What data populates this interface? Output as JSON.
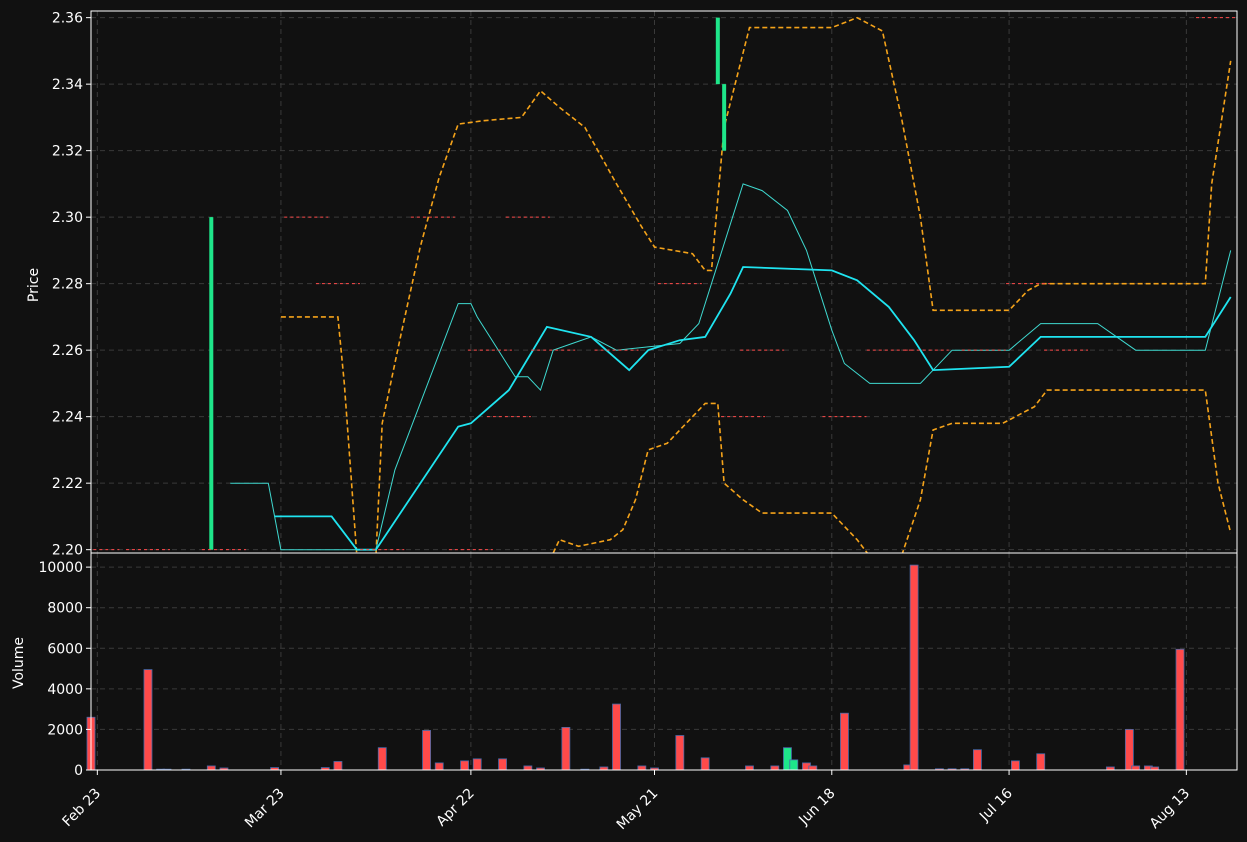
{
  "chart_data": [
    {
      "type": "candlestick",
      "ylabel": "Price",
      "ylim": [
        2.199,
        2.362
      ],
      "ytick_values": [
        2.2,
        2.22,
        2.24,
        2.26,
        2.28,
        2.3,
        2.32,
        2.34,
        2.36
      ],
      "ytick_labels": [
        "2.20",
        "2.22",
        "2.24",
        "2.26",
        "2.28",
        "2.30",
        "2.32",
        "2.34",
        "2.36"
      ],
      "xlim": [
        "2024-02-22",
        "2024-08-21"
      ],
      "xtick_values": [
        "2024-02-23",
        "2024-03-23",
        "2024-04-22",
        "2024-05-21",
        "2024-06-18",
        "2024-07-16",
        "2024-08-13"
      ],
      "xtick_labels": [
        "Feb 23",
        "Mar 23",
        "Apr 22",
        "May 21",
        "Jun 18",
        "Jul 16",
        "Aug 13"
      ],
      "grid": true,
      "colors": {
        "up": "#1ee68a",
        "down": "#ff4a4a",
        "sma_fast": "#3fd9d0",
        "sma_slow": "#1fe4f0",
        "bands": "#f5a31a",
        "background": "#111111"
      },
      "candles": [
        {
          "date": "2024-02-23",
          "open": 2.2,
          "high": 2.2,
          "low": 2.2,
          "close": 2.2
        },
        {
          "date": "2024-03-02",
          "open": 2.2,
          "high": 2.2,
          "low": 2.2,
          "close": 2.2
        },
        {
          "date": "2024-03-12",
          "open": 2.2,
          "high": 2.3,
          "low": 2.2,
          "close": 2.3
        },
        {
          "date": "2024-03-14",
          "open": 2.2,
          "high": 2.2,
          "low": 2.2,
          "close": 2.2
        },
        {
          "date": "2024-03-27",
          "open": 2.3,
          "high": 2.3,
          "low": 2.3,
          "close": 2.3
        },
        {
          "date": "2024-04-01",
          "open": 2.28,
          "high": 2.28,
          "low": 2.28,
          "close": 2.28
        },
        {
          "date": "2024-04-08",
          "open": 2.2,
          "high": 2.2,
          "low": 2.2,
          "close": 2.2
        },
        {
          "date": "2024-04-16",
          "open": 2.3,
          "high": 2.3,
          "low": 2.3,
          "close": 2.3
        },
        {
          "date": "2024-04-22",
          "open": 2.2,
          "high": 2.2,
          "low": 2.2,
          "close": 2.2
        },
        {
          "date": "2024-04-25",
          "open": 2.26,
          "high": 2.26,
          "low": 2.26,
          "close": 2.26
        },
        {
          "date": "2024-04-28",
          "open": 2.24,
          "high": 2.24,
          "low": 2.24,
          "close": 2.24
        },
        {
          "date": "2024-05-01",
          "open": 2.3,
          "high": 2.3,
          "low": 2.3,
          "close": 2.3
        },
        {
          "date": "2024-05-05",
          "open": 2.26,
          "high": 2.26,
          "low": 2.26,
          "close": 2.26
        },
        {
          "date": "2024-05-15",
          "open": 2.26,
          "high": 2.26,
          "low": 2.26,
          "close": 2.26
        },
        {
          "date": "2024-05-25",
          "open": 2.28,
          "high": 2.28,
          "low": 2.28,
          "close": 2.28
        },
        {
          "date": "2024-05-31",
          "open": 2.34,
          "high": 2.36,
          "low": 2.34,
          "close": 2.36
        },
        {
          "date": "2024-06-01",
          "open": 2.32,
          "high": 2.34,
          "low": 2.32,
          "close": 2.34
        },
        {
          "date": "2024-06-04",
          "open": 2.24,
          "high": 2.24,
          "low": 2.24,
          "close": 2.24
        },
        {
          "date": "2024-06-07",
          "open": 2.26,
          "high": 2.26,
          "low": 2.26,
          "close": 2.26
        },
        {
          "date": "2024-06-20",
          "open": 2.24,
          "high": 2.24,
          "low": 2.24,
          "close": 2.24
        },
        {
          "date": "2024-06-27",
          "open": 2.26,
          "high": 2.26,
          "low": 2.26,
          "close": 2.26
        },
        {
          "date": "2024-07-03",
          "open": 2.26,
          "high": 2.26,
          "low": 2.26,
          "close": 2.26
        },
        {
          "date": "2024-07-12",
          "open": 2.26,
          "high": 2.26,
          "low": 2.26,
          "close": 2.26
        },
        {
          "date": "2024-07-19",
          "open": 2.28,
          "high": 2.28,
          "low": 2.28,
          "close": 2.28
        },
        {
          "date": "2024-07-25",
          "open": 2.26,
          "high": 2.26,
          "low": 2.26,
          "close": 2.26
        },
        {
          "date": "2024-08-18",
          "open": 2.36,
          "high": 2.36,
          "low": 2.36,
          "close": 2.36
        }
      ],
      "sma_fast": [
        {
          "date": "2024-03-15",
          "value": 2.22
        },
        {
          "date": "2024-03-21",
          "value": 2.22
        },
        {
          "date": "2024-03-23",
          "value": 2.2
        },
        {
          "date": "2024-04-03",
          "value": 2.2
        },
        {
          "date": "2024-04-07",
          "value": 2.2
        },
        {
          "date": "2024-04-10",
          "value": 2.224
        },
        {
          "date": "2024-04-20",
          "value": 2.274
        },
        {
          "date": "2024-04-22",
          "value": 2.274
        },
        {
          "date": "2024-04-23",
          "value": 2.27
        },
        {
          "date": "2024-04-25",
          "value": 2.264
        },
        {
          "date": "2024-04-29",
          "value": 2.252
        },
        {
          "date": "2024-05-01",
          "value": 2.252
        },
        {
          "date": "2024-05-03",
          "value": 2.248
        },
        {
          "date": "2024-05-05",
          "value": 2.26
        },
        {
          "date": "2024-05-08",
          "value": 2.262
        },
        {
          "date": "2024-05-11",
          "value": 2.264
        },
        {
          "date": "2024-05-15",
          "value": 2.26
        },
        {
          "date": "2024-05-25",
          "value": 2.262
        },
        {
          "date": "2024-05-28",
          "value": 2.268
        },
        {
          "date": "2024-05-31",
          "value": 2.286
        },
        {
          "date": "2024-06-04",
          "value": 2.31
        },
        {
          "date": "2024-06-07",
          "value": 2.308
        },
        {
          "date": "2024-06-11",
          "value": 2.302
        },
        {
          "date": "2024-06-14",
          "value": 2.29
        },
        {
          "date": "2024-06-18",
          "value": 2.266
        },
        {
          "date": "2024-06-20",
          "value": 2.256
        },
        {
          "date": "2024-06-24",
          "value": 2.25
        },
        {
          "date": "2024-07-02",
          "value": 2.25
        },
        {
          "date": "2024-07-07",
          "value": 2.26
        },
        {
          "date": "2024-07-16",
          "value": 2.26
        },
        {
          "date": "2024-07-21",
          "value": 2.268
        },
        {
          "date": "2024-07-30",
          "value": 2.268
        },
        {
          "date": "2024-08-05",
          "value": 2.26
        },
        {
          "date": "2024-08-16",
          "value": 2.26
        },
        {
          "date": "2024-08-20",
          "value": 2.29
        }
      ],
      "sma_slow": [
        {
          "date": "2024-03-22",
          "value": 2.21
        },
        {
          "date": "2024-03-31",
          "value": 2.21
        },
        {
          "date": "2024-04-04",
          "value": 2.2
        },
        {
          "date": "2024-04-07",
          "value": 2.2
        },
        {
          "date": "2024-04-20",
          "value": 2.237
        },
        {
          "date": "2024-04-22",
          "value": 2.238
        },
        {
          "date": "2024-04-28",
          "value": 2.248
        },
        {
          "date": "2024-05-04",
          "value": 2.267
        },
        {
          "date": "2024-05-11",
          "value": 2.264
        },
        {
          "date": "2024-05-17",
          "value": 2.254
        },
        {
          "date": "2024-05-20",
          "value": 2.26
        },
        {
          "date": "2024-05-25",
          "value": 2.263
        },
        {
          "date": "2024-05-29",
          "value": 2.264
        },
        {
          "date": "2024-06-02",
          "value": 2.277
        },
        {
          "date": "2024-06-04",
          "value": 2.285
        },
        {
          "date": "2024-06-18",
          "value": 2.284
        },
        {
          "date": "2024-06-22",
          "value": 2.281
        },
        {
          "date": "2024-06-27",
          "value": 2.273
        },
        {
          "date": "2024-07-01",
          "value": 2.263
        },
        {
          "date": "2024-07-04",
          "value": 2.254
        },
        {
          "date": "2024-07-16",
          "value": 2.255
        },
        {
          "date": "2024-07-21",
          "value": 2.264
        },
        {
          "date": "2024-08-16",
          "value": 2.264
        },
        {
          "date": "2024-08-20",
          "value": 2.276
        }
      ],
      "band_upper": [
        {
          "date": "2024-03-23",
          "value": 2.27
        },
        {
          "date": "2024-04-01",
          "value": 2.27
        },
        {
          "date": "2024-04-02",
          "value": 2.25
        },
        {
          "date": "2024-04-04",
          "value": 2.198
        },
        {
          "date": "2024-04-07",
          "value": 2.198
        },
        {
          "date": "2024-04-08",
          "value": 2.238
        },
        {
          "date": "2024-04-11",
          "value": 2.265
        },
        {
          "date": "2024-04-14",
          "value": 2.291
        },
        {
          "date": "2024-04-17",
          "value": 2.312
        },
        {
          "date": "2024-04-20",
          "value": 2.328
        },
        {
          "date": "2024-04-24",
          "value": 2.329
        },
        {
          "date": "2024-04-30",
          "value": 2.33
        },
        {
          "date": "2024-05-03",
          "value": 2.338
        },
        {
          "date": "2024-05-06",
          "value": 2.333
        },
        {
          "date": "2024-05-10",
          "value": 2.327
        },
        {
          "date": "2024-05-15",
          "value": 2.31
        },
        {
          "date": "2024-05-19",
          "value": 2.297
        },
        {
          "date": "2024-05-21",
          "value": 2.291
        },
        {
          "date": "2024-05-27",
          "value": 2.289
        },
        {
          "date": "2024-05-29",
          "value": 2.284
        },
        {
          "date": "2024-05-30",
          "value": 2.284
        },
        {
          "date": "2024-06-01",
          "value": 2.327
        },
        {
          "date": "2024-06-05",
          "value": 2.357
        },
        {
          "date": "2024-06-18",
          "value": 2.357
        },
        {
          "date": "2024-06-22",
          "value": 2.36
        },
        {
          "date": "2024-06-26",
          "value": 2.356
        },
        {
          "date": "2024-06-29",
          "value": 2.33
        },
        {
          "date": "2024-07-02",
          "value": 2.3
        },
        {
          "date": "2024-07-04",
          "value": 2.272
        },
        {
          "date": "2024-07-16",
          "value": 2.272
        },
        {
          "date": "2024-07-19",
          "value": 2.278
        },
        {
          "date": "2024-07-21",
          "value": 2.28
        },
        {
          "date": "2024-08-16",
          "value": 2.28
        },
        {
          "date": "2024-08-17",
          "value": 2.31
        },
        {
          "date": "2024-08-20",
          "value": 2.347
        }
      ],
      "band_lower": [
        {
          "date": "2024-05-05",
          "value": 2.199
        },
        {
          "date": "2024-05-06",
          "value": 2.203
        },
        {
          "date": "2024-05-09",
          "value": 2.201
        },
        {
          "date": "2024-05-14",
          "value": 2.203
        },
        {
          "date": "2024-05-16",
          "value": 2.206
        },
        {
          "date": "2024-05-18",
          "value": 2.215
        },
        {
          "date": "2024-05-20",
          "value": 2.23
        },
        {
          "date": "2024-05-23",
          "value": 2.232
        },
        {
          "date": "2024-05-27",
          "value": 2.24
        },
        {
          "date": "2024-05-29",
          "value": 2.244
        },
        {
          "date": "2024-05-31",
          "value": 2.244
        },
        {
          "date": "2024-06-01",
          "value": 2.22
        },
        {
          "date": "2024-06-04",
          "value": 2.215
        },
        {
          "date": "2024-06-07",
          "value": 2.211
        },
        {
          "date": "2024-06-18",
          "value": 2.211
        },
        {
          "date": "2024-06-22",
          "value": 2.203
        },
        {
          "date": "2024-06-24",
          "value": 2.198
        },
        {
          "date": "2024-06-29",
          "value": 2.198
        },
        {
          "date": "2024-07-02",
          "value": 2.215
        },
        {
          "date": "2024-07-04",
          "value": 2.236
        },
        {
          "date": "2024-07-07",
          "value": 2.238
        },
        {
          "date": "2024-07-15",
          "value": 2.238
        },
        {
          "date": "2024-07-17",
          "value": 2.24
        },
        {
          "date": "2024-07-20",
          "value": 2.243
        },
        {
          "date": "2024-07-22",
          "value": 2.248
        },
        {
          "date": "2024-08-16",
          "value": 2.248
        },
        {
          "date": "2024-08-18",
          "value": 2.22
        },
        {
          "date": "2024-08-20",
          "value": 2.205
        }
      ]
    },
    {
      "type": "bar",
      "ylabel": "Volume",
      "ylim": [
        0,
        10400
      ],
      "ytick_values": [
        0,
        2000,
        4000,
        6000,
        8000,
        10000
      ],
      "ytick_labels": [
        "0",
        "2000",
        "4000",
        "6000",
        "8000",
        "10000"
      ],
      "xlim": [
        "2024-02-22",
        "2024-08-21"
      ],
      "grid": true,
      "bars": [
        {
          "date": "2024-02-22",
          "value": 2600,
          "dir": "down"
        },
        {
          "date": "2024-03-02",
          "value": 4950,
          "dir": "down"
        },
        {
          "date": "2024-03-04",
          "value": 40,
          "dir": "down"
        },
        {
          "date": "2024-03-05",
          "value": 40,
          "dir": "down"
        },
        {
          "date": "2024-03-08",
          "value": 40,
          "dir": "down"
        },
        {
          "date": "2024-03-12",
          "value": 200,
          "dir": "down"
        },
        {
          "date": "2024-03-14",
          "value": 100,
          "dir": "down"
        },
        {
          "date": "2024-03-22",
          "value": 120,
          "dir": "down"
        },
        {
          "date": "2024-03-30",
          "value": 120,
          "dir": "down"
        },
        {
          "date": "2024-04-01",
          "value": 420,
          "dir": "down"
        },
        {
          "date": "2024-04-08",
          "value": 1100,
          "dir": "down"
        },
        {
          "date": "2024-04-15",
          "value": 1950,
          "dir": "down"
        },
        {
          "date": "2024-04-17",
          "value": 350,
          "dir": "down"
        },
        {
          "date": "2024-04-21",
          "value": 450,
          "dir": "down"
        },
        {
          "date": "2024-04-23",
          "value": 550,
          "dir": "down"
        },
        {
          "date": "2024-04-27",
          "value": 550,
          "dir": "down"
        },
        {
          "date": "2024-05-01",
          "value": 200,
          "dir": "down"
        },
        {
          "date": "2024-05-03",
          "value": 100,
          "dir": "down"
        },
        {
          "date": "2024-05-07",
          "value": 2100,
          "dir": "down"
        },
        {
          "date": "2024-05-10",
          "value": 40,
          "dir": "down"
        },
        {
          "date": "2024-05-13",
          "value": 150,
          "dir": "down"
        },
        {
          "date": "2024-05-15",
          "value": 3250,
          "dir": "down"
        },
        {
          "date": "2024-05-19",
          "value": 200,
          "dir": "down"
        },
        {
          "date": "2024-05-21",
          "value": 100,
          "dir": "down"
        },
        {
          "date": "2024-05-25",
          "value": 1700,
          "dir": "down"
        },
        {
          "date": "2024-05-29",
          "value": 600,
          "dir": "down"
        },
        {
          "date": "2024-06-05",
          "value": 200,
          "dir": "down"
        },
        {
          "date": "2024-06-09",
          "value": 200,
          "dir": "down"
        },
        {
          "date": "2024-06-11",
          "value": 1100,
          "dir": "up"
        },
        {
          "date": "2024-06-12",
          "value": 500,
          "dir": "up"
        },
        {
          "date": "2024-06-14",
          "value": 350,
          "dir": "down"
        },
        {
          "date": "2024-06-15",
          "value": 200,
          "dir": "down"
        },
        {
          "date": "2024-06-20",
          "value": 2800,
          "dir": "down"
        },
        {
          "date": "2024-06-30",
          "value": 250,
          "dir": "down"
        },
        {
          "date": "2024-07-01",
          "value": 10100,
          "dir": "down"
        },
        {
          "date": "2024-07-05",
          "value": 60,
          "dir": "down"
        },
        {
          "date": "2024-07-07",
          "value": 60,
          "dir": "down"
        },
        {
          "date": "2024-07-09",
          "value": 60,
          "dir": "down"
        },
        {
          "date": "2024-07-11",
          "value": 1000,
          "dir": "down"
        },
        {
          "date": "2024-07-17",
          "value": 450,
          "dir": "down"
        },
        {
          "date": "2024-07-21",
          "value": 800,
          "dir": "down"
        },
        {
          "date": "2024-08-01",
          "value": 150,
          "dir": "down"
        },
        {
          "date": "2024-08-04",
          "value": 2000,
          "dir": "down"
        },
        {
          "date": "2024-08-05",
          "value": 200,
          "dir": "down"
        },
        {
          "date": "2024-08-07",
          "value": 200,
          "dir": "down"
        },
        {
          "date": "2024-08-08",
          "value": 150,
          "dir": "down"
        },
        {
          "date": "2024-08-12",
          "value": 5950,
          "dir": "down"
        }
      ]
    }
  ]
}
